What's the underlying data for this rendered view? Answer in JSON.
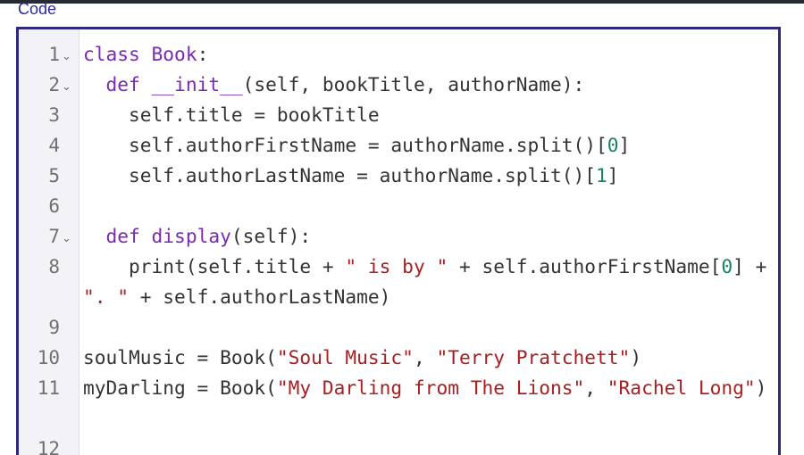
{
  "section_label": "Code",
  "editor": {
    "lines": [
      {
        "num": "1",
        "fold": "⌄",
        "tokens": [
          [
            "kw",
            "class "
          ],
          [
            "fn",
            "Book"
          ],
          [
            "p",
            ":"
          ]
        ]
      },
      {
        "num": "2",
        "fold": "⌄",
        "tokens": [
          [
            "p",
            "  "
          ],
          [
            "kw",
            "def "
          ],
          [
            "fn",
            "__init__"
          ],
          [
            "p",
            "(self, bookTitle, authorName):"
          ]
        ]
      },
      {
        "num": "3",
        "fold": "",
        "tokens": [
          [
            "p",
            "    self.title = bookTitle"
          ]
        ]
      },
      {
        "num": "4",
        "fold": "",
        "tokens": [
          [
            "p",
            "    self.authorFirstName = authorName.split()["
          ],
          [
            "num",
            "0"
          ],
          [
            "p",
            "]"
          ]
        ]
      },
      {
        "num": "5",
        "fold": "",
        "tokens": [
          [
            "p",
            "    self.authorLastName = authorName.split()["
          ],
          [
            "num",
            "1"
          ],
          [
            "p",
            "]"
          ]
        ]
      },
      {
        "num": "6",
        "fold": "",
        "tokens": [
          [
            "p",
            " "
          ]
        ]
      },
      {
        "num": "7",
        "fold": "⌄",
        "tokens": [
          [
            "p",
            "  "
          ],
          [
            "kw",
            "def "
          ],
          [
            "fn",
            "display"
          ],
          [
            "p",
            "(self):"
          ]
        ]
      },
      {
        "num": "8",
        "fold": "",
        "wrap": true,
        "tokens": [
          [
            "p",
            "    print(self.title + "
          ],
          [
            "str",
            "\" is by \""
          ],
          [
            "p",
            " + self.authorFirstName["
          ],
          [
            "num",
            "0"
          ],
          [
            "p",
            "] + "
          ],
          [
            "str",
            "\". \""
          ],
          [
            "p",
            " + self.authorLastName)"
          ]
        ]
      },
      {
        "num": "9",
        "fold": "",
        "tokens": [
          [
            "p",
            " "
          ]
        ]
      },
      {
        "num": "10",
        "fold": "",
        "tokens": [
          [
            "p",
            "soulMusic = Book("
          ],
          [
            "str",
            "\"Soul Music\""
          ],
          [
            "p",
            ", "
          ],
          [
            "str",
            "\"Terry Pratchett\""
          ],
          [
            "p",
            ")"
          ]
        ]
      },
      {
        "num": "11",
        "fold": "",
        "wrap": true,
        "tokens": [
          [
            "p",
            "myDarling = Book("
          ],
          [
            "str",
            "\"My Darling from The Lions\""
          ],
          [
            "p",
            ", "
          ],
          [
            "str",
            "\"Rachel Long\""
          ],
          [
            "p",
            ")"
          ]
        ]
      },
      {
        "num": "12",
        "fold": "",
        "tokens": [
          [
            "p",
            " "
          ]
        ]
      }
    ]
  },
  "colors": {
    "border": "#2d2a7e",
    "keyword": "#7b28b4",
    "string": "#a81e21",
    "number": "#17865b",
    "plain": "#333333"
  }
}
